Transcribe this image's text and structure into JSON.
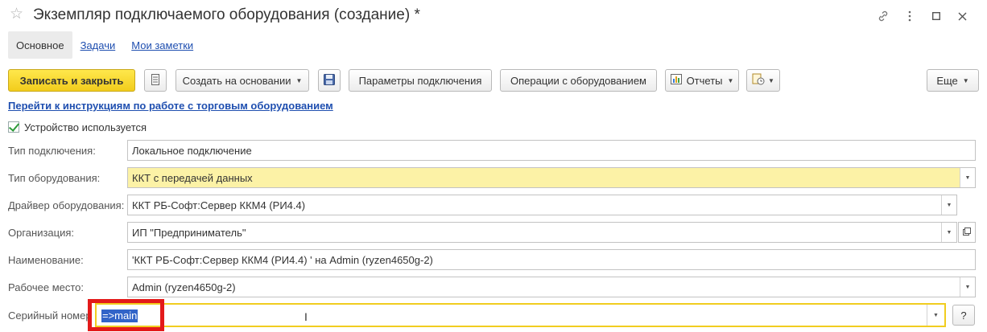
{
  "window": {
    "title": "Экземпляр подключаемого оборудования (создание) *"
  },
  "tabs": [
    {
      "label": "Основное"
    },
    {
      "label": "Задачи"
    },
    {
      "label": "Мои заметки"
    }
  ],
  "toolbar": {
    "save_close": "Записать и закрыть",
    "create_based_on": "Создать на основании",
    "connection_params": "Параметры подключения",
    "equipment_ops": "Операции с оборудованием",
    "reports": "Отчеты",
    "more": "Еще"
  },
  "help_link": "Перейти к инструкциям по работе с торговым оборудованием",
  "device_used": {
    "label": "Устройство используется",
    "checked": true
  },
  "form": {
    "connection_type": {
      "label": "Тип подключения:",
      "value": "Локальное подключение"
    },
    "equipment_type": {
      "label": "Тип оборудования:",
      "value": "ККТ с передачей данных"
    },
    "driver": {
      "label": "Драйвер оборудования:",
      "value": "ККТ РБ-Софт:Сервер ККМ4 (РИ4.4)"
    },
    "organization": {
      "label": "Организация:",
      "value": "ИП \"Предприниматель\""
    },
    "name": {
      "label": "Наименование:",
      "value": "'ККТ РБ-Софт:Сервер ККМ4 (РИ4.4) ' на Admin (ryzen4650g-2)"
    },
    "workplace": {
      "label": "Рабочее место:",
      "value": "Admin (ryzen4650g-2)"
    },
    "serial": {
      "label": "Серийный номер",
      "value": "=>main"
    }
  },
  "help_button": "?",
  "colors": {
    "primary_button": "#f2cc1c",
    "highlight_field": "#fcf2a6",
    "link": "#1f4fb0",
    "annotation_box": "#e31a1a"
  }
}
